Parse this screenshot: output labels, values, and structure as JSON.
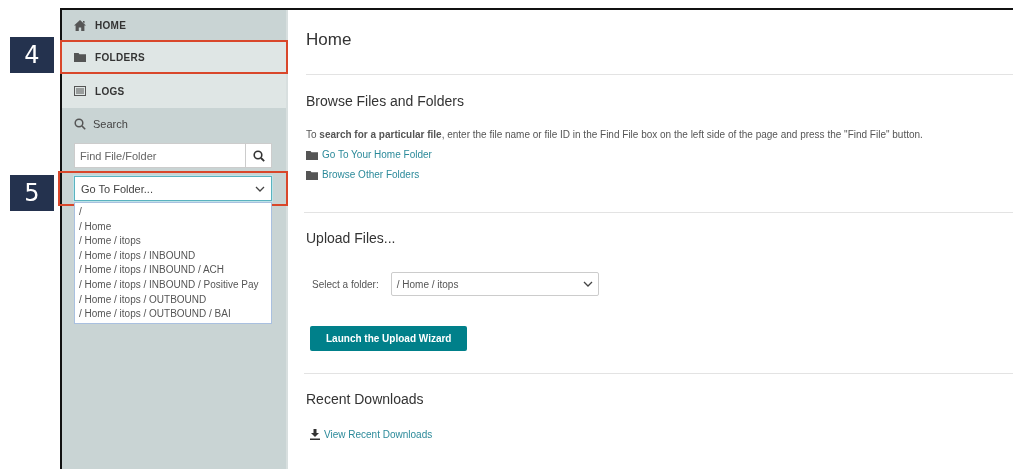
{
  "callouts": [
    {
      "label": "4"
    },
    {
      "label": "5"
    }
  ],
  "sidebar": {
    "items": [
      {
        "label": "HOME",
        "kind": "home",
        "selected": true,
        "outlined": false
      },
      {
        "label": "FOLDERS",
        "kind": "folder",
        "selected": false,
        "outlined": true
      },
      {
        "label": "LOGS",
        "kind": "list",
        "selected": false,
        "outlined": false
      }
    ],
    "search": {
      "label": "Search",
      "placeholder": "Find File/Folder"
    },
    "folder_select": {
      "value": "Go To Folder...",
      "outlined": true,
      "expanded": true,
      "options": [
        "/",
        "/ Home",
        "/ Home / itops",
        "/ Home / itops / INBOUND",
        "/ Home / itops / INBOUND / ACH",
        "/ Home / itops / INBOUND / Positive Pay",
        "/ Home / itops / OUTBOUND",
        "/ Home / itops / OUTBOUND / BAI"
      ]
    }
  },
  "main": {
    "title": "Home",
    "browse": {
      "heading": "Browse Files and Folders",
      "text": "To **search for a particular file**, enter the file name or file ID in the Find File box on the left side of the page and press the \"Find File\" button.",
      "links": [
        "Go To Your Home Folder",
        "Browse Other Folders"
      ]
    },
    "upload": {
      "heading": "Upload Files...",
      "select_label": "Select a folder:",
      "select_value": "/ Home / itops",
      "button": "Launch the Upload Wizard"
    },
    "downloads": {
      "heading": "Recent Downloads",
      "link": "View Recent Downloads"
    }
  }
}
